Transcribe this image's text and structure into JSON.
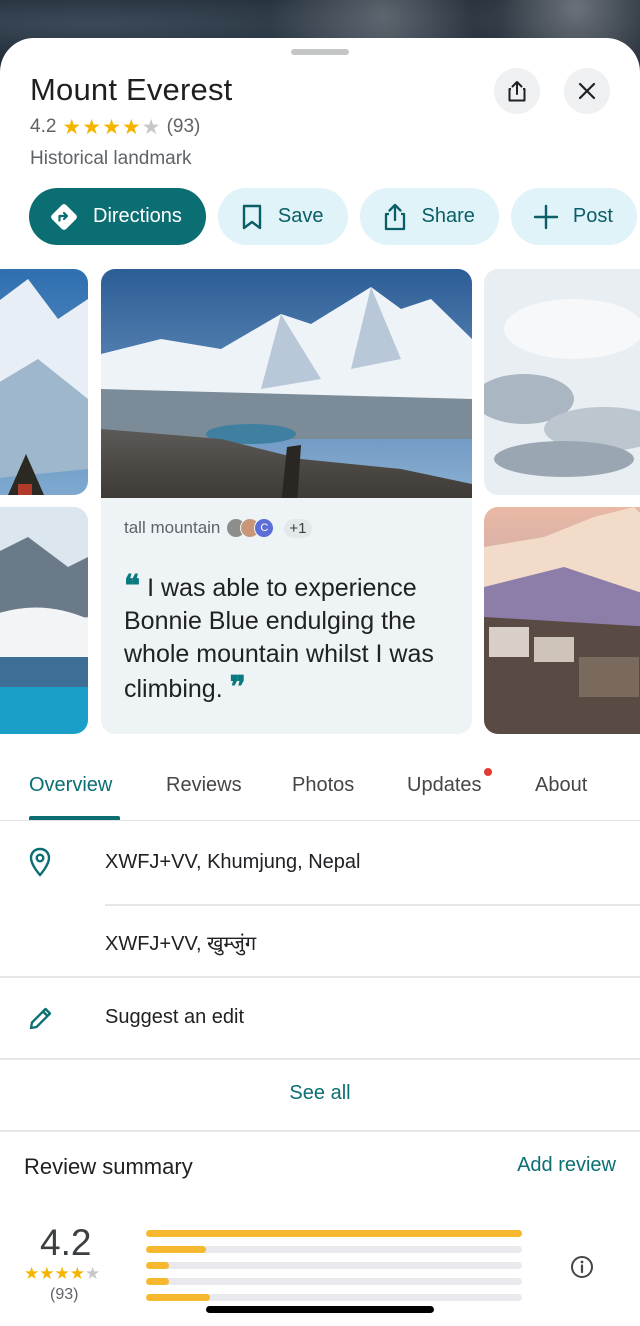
{
  "place": {
    "title": "Mount Everest",
    "rating": "4.2",
    "rating_value": 4.2,
    "review_count": "(93)",
    "category": "Historical landmark"
  },
  "actions": [
    {
      "label": "Directions",
      "icon": "directions-icon",
      "primary": true
    },
    {
      "label": "Save",
      "icon": "bookmark-icon"
    },
    {
      "label": "Share",
      "icon": "share-icon"
    },
    {
      "label": "Post",
      "icon": "plus-icon"
    }
  ],
  "review_snippet": {
    "source": "tall mountain",
    "avatar_letter": "C",
    "extra_count": "+1",
    "open_quote": "❝",
    "text": "I was able to experience Bonnie Blue endulging the whole mountain whilst I was climbing.",
    "close_quote": "❞"
  },
  "tabs": [
    {
      "label": "Overview",
      "active": true
    },
    {
      "label": "Reviews"
    },
    {
      "label": "Photos"
    },
    {
      "label": "Updates",
      "has_dot": true
    },
    {
      "label": "About"
    }
  ],
  "details": {
    "plus_code": "XWFJ+VV, Khumjung, Nepal",
    "plus_code_local": "XWFJ+VV, खुम्जुंग",
    "suggest_edit": "Suggest an edit",
    "see_all": "See all"
  },
  "review_summary": {
    "title": "Review summary",
    "add_review": "Add review",
    "rating": "4.2",
    "count": "(93)",
    "distribution": [
      {
        "stars": 5,
        "fraction": 1.0
      },
      {
        "stars": 4,
        "fraction": 0.16
      },
      {
        "stars": 3,
        "fraction": 0.06
      },
      {
        "stars": 2,
        "fraction": 0.06
      },
      {
        "stars": 1,
        "fraction": 0.17
      }
    ]
  },
  "colors": {
    "accent": "#0b6e73",
    "chip_bg": "#dff3f8",
    "star": "#f4b400",
    "bar_fill": "#f6b82e"
  }
}
